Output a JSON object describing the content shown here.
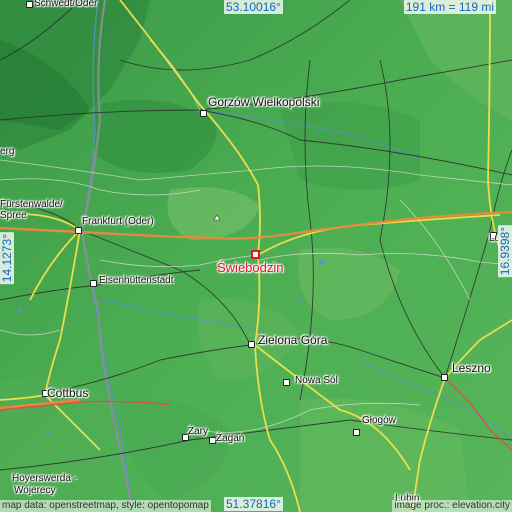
{
  "map": {
    "title": "Świebodzin",
    "scale": "191 km = 119 mi",
    "coords": {
      "top_lat": "53.10016°",
      "bottom_lat": "51.37816°",
      "left_lon": "14.1273°",
      "right_lon": "16.9398°"
    },
    "attribution_left": "map data: openstreetmap, style: opentopomap",
    "attribution_right": "image proc.: elevation.city",
    "places": {
      "schwedt": "Schwedt/Oder",
      "gorzow": "Gorzów Wielkopolski",
      "frankfurt": "Frankfurt (Oder)",
      "furstenwalde": "Fürstenwalde/",
      "spree": "Spree",
      "erg": "erg",
      "eisenhuttenstadt": "Eisenhüttenstadt",
      "swiebodzin": "Świebodzin",
      "zielona_gora": "Zielona Góra",
      "cottbus": "Cottbus",
      "nowa_sol": "Nowa Sól",
      "leszno": "Leszno",
      "glogow": "Głogów",
      "zary": "Żary",
      "zagan": "Żagań",
      "hoyerswerda": "Hoyerswerda -",
      "wojerecy": "Wojerecy",
      "lubin": "Lubin",
      "lu": "Lu"
    }
  }
}
